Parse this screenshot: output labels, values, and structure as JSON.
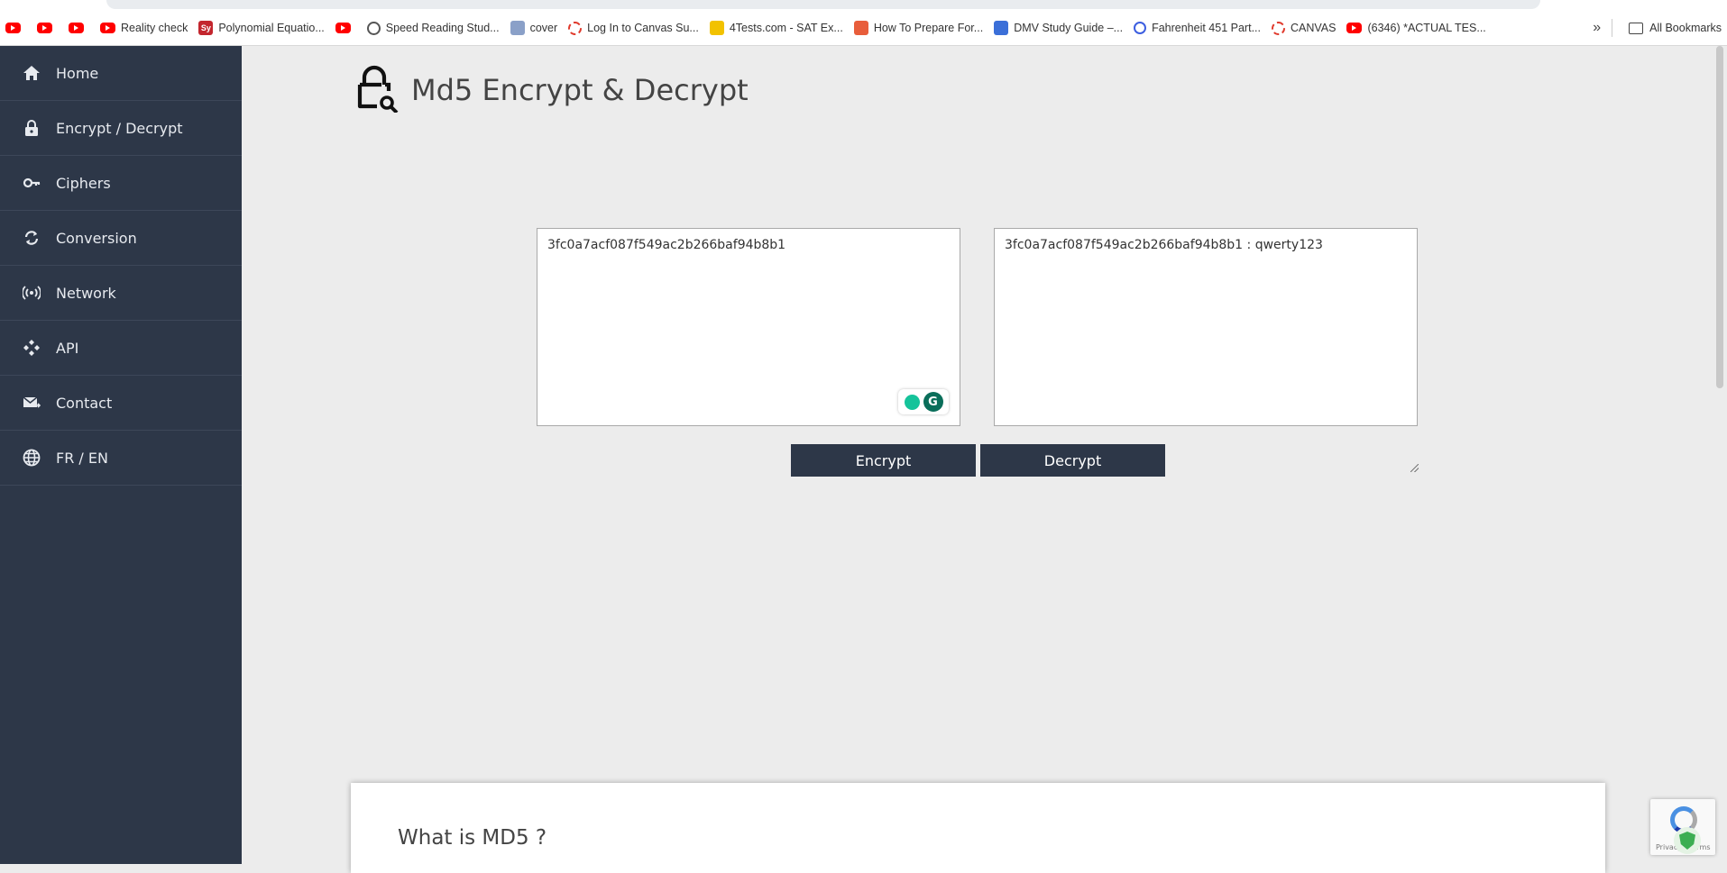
{
  "bookmarks": {
    "items": [
      {
        "icon": "youtube-icon",
        "label": ""
      },
      {
        "icon": "youtube-icon",
        "label": ""
      },
      {
        "icon": "youtube-icon",
        "label": ""
      },
      {
        "icon": "youtube-icon",
        "label": "Reality check"
      },
      {
        "icon": "symbolab-icon",
        "label": "Polynomial Equatio..."
      },
      {
        "icon": "youtube-icon",
        "label": ""
      },
      {
        "icon": "globe-icon",
        "label": "Speed Reading Stud..."
      },
      {
        "icon": "cover-icon",
        "label": "cover"
      },
      {
        "icon": "canvas-icon",
        "label": "Log In to Canvas Su..."
      },
      {
        "icon": "4tests-icon",
        "label": "4Tests.com - SAT Ex..."
      },
      {
        "icon": "book-icon",
        "label": "How To Prepare For..."
      },
      {
        "icon": "dmv-icon",
        "label": "DMV Study Guide –..."
      },
      {
        "icon": "quizlet-icon",
        "label": "Fahrenheit 451 Part..."
      },
      {
        "icon": "canvas-icon",
        "label": "CANVAS"
      },
      {
        "icon": "youtube-icon",
        "label": "(6346) *ACTUAL TES..."
      }
    ],
    "more": "»",
    "all_bookmarks": "All Bookmarks"
  },
  "sidebar": {
    "items": [
      {
        "label": "Home",
        "icon": "home-icon"
      },
      {
        "label": "Encrypt / Decrypt",
        "icon": "lock-icon"
      },
      {
        "label": "Ciphers",
        "icon": "key-icon"
      },
      {
        "label": "Conversion",
        "icon": "refresh-icon"
      },
      {
        "label": "Network",
        "icon": "broadcast-icon"
      },
      {
        "label": "API",
        "icon": "api-icon"
      },
      {
        "label": "Contact",
        "icon": "mail-icon"
      },
      {
        "label": "FR / EN",
        "icon": "globe-icon"
      }
    ]
  },
  "main": {
    "title": "Md5 Encrypt & Decrypt",
    "input_value": "3fc0a7acf087f549ac2b266baf94b8b1",
    "output_value": "3fc0a7acf087f549ac2b266baf94b8b1 : qwerty123",
    "encrypt_label": "Encrypt",
    "decrypt_label": "Decrypt",
    "info_heading": "What is MD5 ?"
  },
  "recaptcha": {
    "text": "Privacy - Terms"
  },
  "colors": {
    "sidebar": "#2d3748",
    "background": "#ececec",
    "button": "#2d3748"
  }
}
